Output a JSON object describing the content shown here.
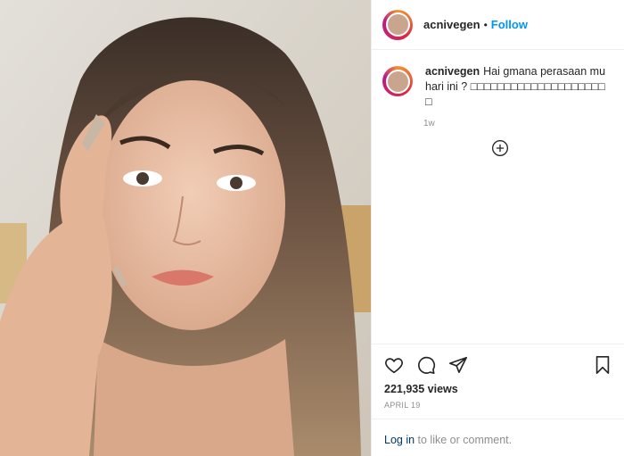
{
  "post": {
    "username": "acnivegen",
    "follow_label": "Follow",
    "separator": "•",
    "caption": "Hai gmana perasaan mu hari ini ? □□□□□□□□□□□□□□□□□□□□□",
    "age": "1w",
    "views": "221,935 views",
    "date": "APRIL 19"
  },
  "footer": {
    "login_link": "Log in",
    "login_text": " to like or comment."
  },
  "icons": {
    "like": "heart-icon",
    "comment": "comment-icon",
    "share": "paper-plane-icon",
    "save": "bookmark-icon",
    "load_more": "plus-circle-icon"
  },
  "colors": {
    "link": "#0095f6",
    "text": "#262626",
    "muted": "#8e8e8e",
    "border": "#efefef"
  }
}
